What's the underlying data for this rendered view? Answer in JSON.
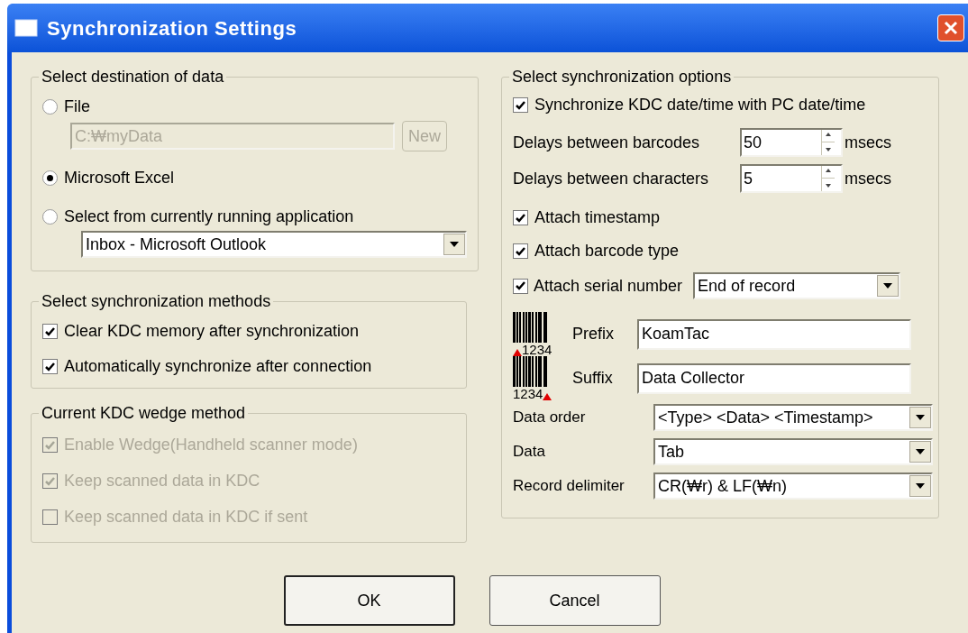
{
  "window": {
    "title": "Synchronization Settings"
  },
  "destination": {
    "legend": "Select destination of data",
    "options": [
      {
        "kind": "file",
        "label": "File",
        "selected": false,
        "path": "C:₩myData",
        "path_disabled": true,
        "button": "New",
        "button_disabled": true
      },
      {
        "kind": "plain",
        "label": "Microsoft Excel",
        "selected": true
      },
      {
        "kind": "app",
        "label": "Select from currently running application",
        "selected": false,
        "dropdown": "Inbox - Microsoft Outlook"
      }
    ]
  },
  "methods": {
    "legend": "Select synchronization methods",
    "items": [
      {
        "label": "Clear KDC memory after synchronization",
        "checked": true,
        "disabled": false
      },
      {
        "label": "Automatically synchronize after connection",
        "checked": true,
        "disabled": false
      }
    ]
  },
  "wedge": {
    "legend": "Current KDC wedge method",
    "items": [
      {
        "label": "Enable Wedge(Handheld scanner mode)",
        "checked": true,
        "disabled": true
      },
      {
        "label": "Keep scanned data in KDC",
        "checked": true,
        "disabled": true
      },
      {
        "label": "Keep scanned data in KDC if sent",
        "checked": false,
        "disabled": true
      }
    ]
  },
  "options": {
    "legend": "Select synchronization options",
    "sync_time": {
      "label": "Synchronize KDC date/time with PC date/time",
      "checked": true
    },
    "delays": [
      {
        "label": "Delays between barcodes",
        "value": "50",
        "unit": "msecs"
      },
      {
        "label": "Delays between characters",
        "value": "5",
        "unit": "msecs"
      }
    ],
    "attach": [
      {
        "label": "Attach timestamp",
        "checked": true
      },
      {
        "label": "Attach barcode type",
        "checked": true
      },
      {
        "label": "Attach serial number",
        "checked": true,
        "dropdown": "End of record"
      }
    ],
    "affixes": [
      {
        "kind": "prefix",
        "digits": "1234",
        "label": "Prefix",
        "value": "KoamTac"
      },
      {
        "kind": "suffix",
        "digits": "1234",
        "label": "Suffix",
        "value": "Data Collector"
      }
    ],
    "selects": [
      {
        "label": "Data order",
        "value": "<Type> <Data> <Timestamp>"
      },
      {
        "label": "Data",
        "value": "Tab"
      },
      {
        "label": "Record delimiter",
        "value": "CR(₩r) & LF(₩n)"
      }
    ]
  },
  "buttons": [
    {
      "label": "OK",
      "default": true
    },
    {
      "label": "Cancel",
      "default": false
    }
  ]
}
